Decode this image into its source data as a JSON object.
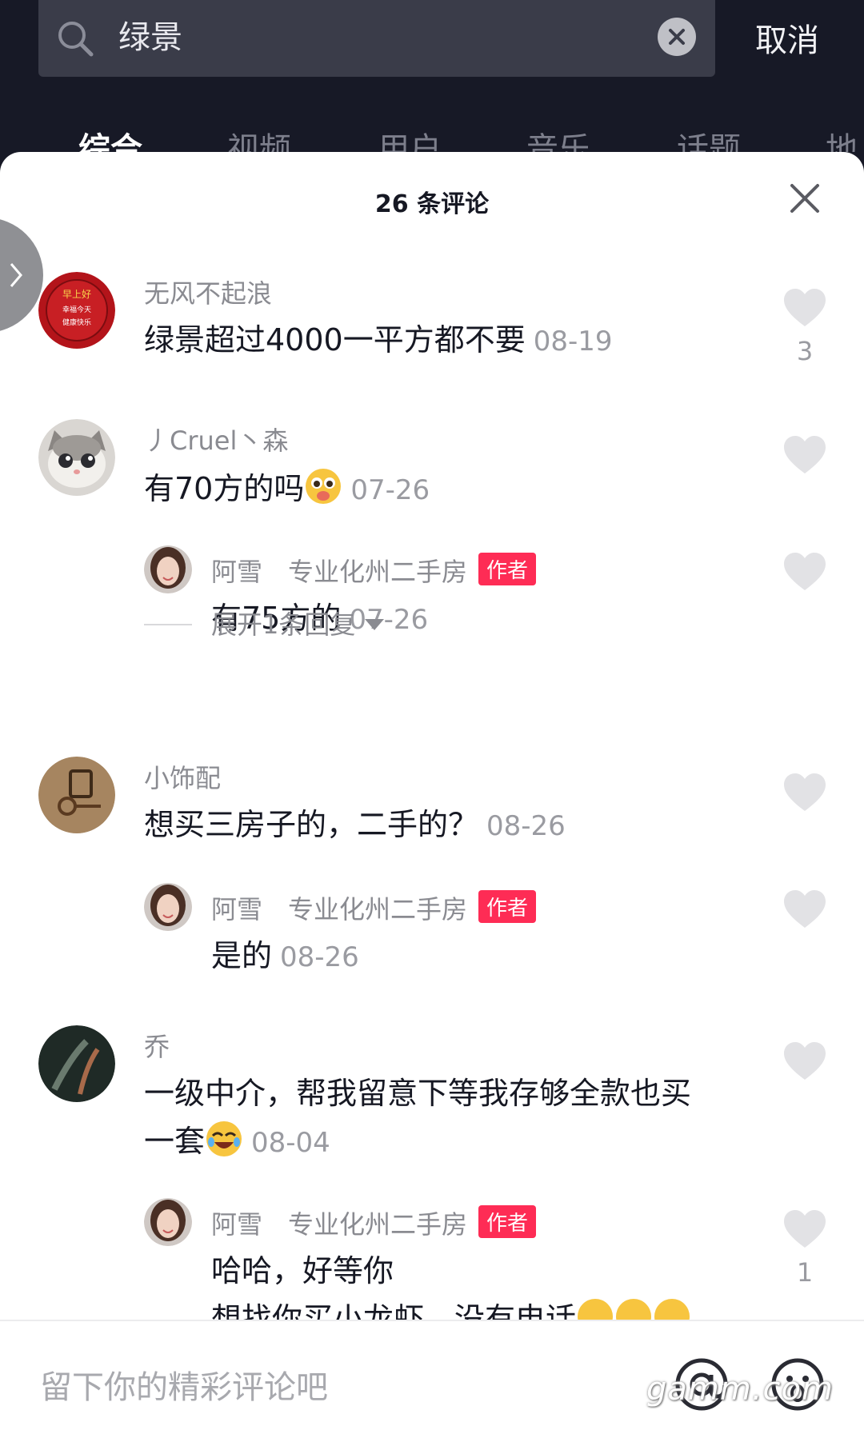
{
  "search": {
    "query": "绿景",
    "cancel_label": "取消"
  },
  "tabs": [
    "综合",
    "视频",
    "用户",
    "音乐",
    "话题",
    "地"
  ],
  "sheet": {
    "title": "26 条评论"
  },
  "comments": [
    {
      "user": "无风不起浪",
      "text": "绿景超过4000一平方都不要",
      "date": "08-19",
      "likes": "3"
    },
    {
      "user": "丿Cruel丶森",
      "text": "有70方的吗",
      "date": "07-26",
      "emoji": "pleading-face"
    },
    {
      "user": "阿雪　专业化州二手房",
      "badge": "作者",
      "text": "有75方的",
      "date": "07-26"
    },
    {
      "user": "小饰配",
      "text": "想买三房子的，二手的？",
      "date": "08-26"
    },
    {
      "user": "阿雪　专业化州二手房",
      "badge": "作者",
      "text": "是的",
      "date": "08-26"
    },
    {
      "user": "乔",
      "text_line1": "一级中介，帮我留意下等我存够全款也买",
      "text_line2": "一套",
      "date": "08-04",
      "emoji": "rolling-laugh-face"
    },
    {
      "user": "阿雪　专业化州二手房",
      "badge": "作者",
      "text_line1": "哈哈，好等你",
      "text_line2": "想找你买小龙虾，没有电话",
      "likes": "1",
      "emoji": "rolling-laugh-face"
    }
  ],
  "expand_replies": "展开1条回复",
  "avatar_badge_text": [
    "早上好",
    "幸福今天",
    "健康快乐"
  ],
  "input": {
    "placeholder": "留下你的精彩评论吧"
  },
  "watermark": "gamm.com",
  "colors": {
    "accent": "#fe2c55",
    "header_bg": "#171926",
    "search_bg": "#3a3c49"
  }
}
